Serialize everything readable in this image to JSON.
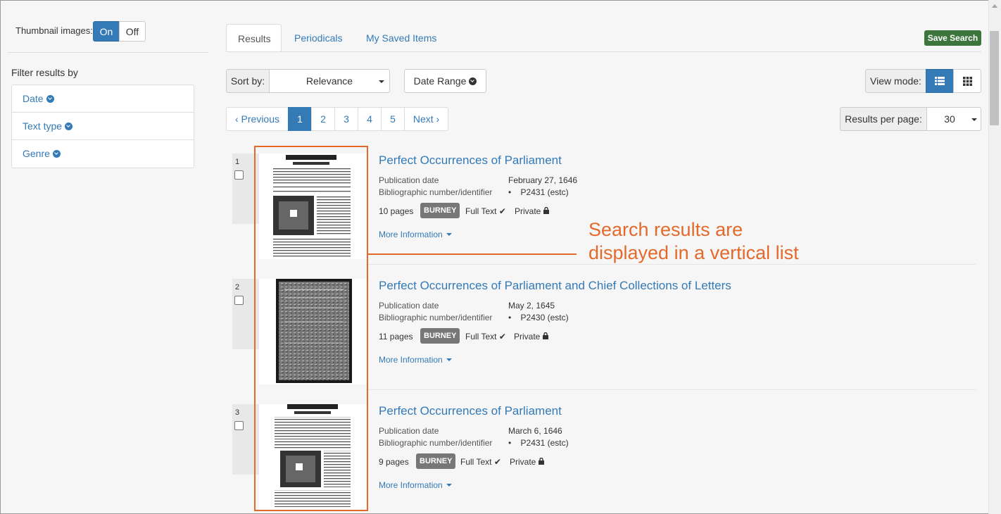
{
  "thumbnail_toggle": {
    "label": "Thumbnail images:",
    "on": "On",
    "off": "Off"
  },
  "tabs": [
    {
      "label": "Results",
      "active": true
    },
    {
      "label": "Periodicals",
      "active": false
    },
    {
      "label": "My Saved Items",
      "active": false
    }
  ],
  "save_search": {
    "label": "Save Search",
    "color": "#3c763d"
  },
  "filters": {
    "heading": "Filter results by",
    "items": [
      {
        "label": "Date"
      },
      {
        "label": "Text type"
      },
      {
        "label": "Genre"
      }
    ]
  },
  "sort": {
    "label": "Sort by:",
    "value": "Relevance"
  },
  "date_range": {
    "label": "Date Range"
  },
  "view_mode": {
    "label": "View mode:",
    "selected": "list"
  },
  "pagination": {
    "previous": "‹ Previous",
    "pages": [
      "1",
      "2",
      "3",
      "4",
      "5"
    ],
    "current": "1",
    "next": "Next ›"
  },
  "per_page": {
    "label": "Results per page:",
    "value": "30"
  },
  "results": [
    {
      "number": "1",
      "title": "Perfect Occurrences of Parliament",
      "pub_label": "Publication date",
      "pub_value": "February 27, 1646",
      "bib_label": "Bibliographic number/identifier",
      "bib_value": "P2431 (estc)",
      "pages": "10 pages",
      "badge": "BURNEY",
      "fulltext": "Full Text",
      "private": "Private",
      "more": "More Information",
      "thumb": "printed"
    },
    {
      "number": "2",
      "title": "Perfect Occurrences of Parliament and Chief Collections of Letters",
      "pub_label": "Publication date",
      "pub_value": "May 2, 1645",
      "bib_label": "Bibliographic number/identifier",
      "bib_value": "P2430 (estc)",
      "pages": "11 pages",
      "badge": "BURNEY",
      "fulltext": "Full Text",
      "private": "Private",
      "more": "More Information",
      "thumb": "dark"
    },
    {
      "number": "3",
      "title": "Perfect Occurrences of Parliament",
      "pub_label": "Publication date",
      "pub_value": "March 6, 1646",
      "bib_label": "Bibliographic number/identifier",
      "bib_value": "P2431 (estc)",
      "pages": "9 pages",
      "badge": "BURNEY",
      "fulltext": "Full Text",
      "private": "Private",
      "more": "More Information",
      "thumb": "printed"
    }
  ],
  "annotation": {
    "line1": "Search results are",
    "line2": "displayed in a vertical list",
    "color": "#e46a2c"
  }
}
